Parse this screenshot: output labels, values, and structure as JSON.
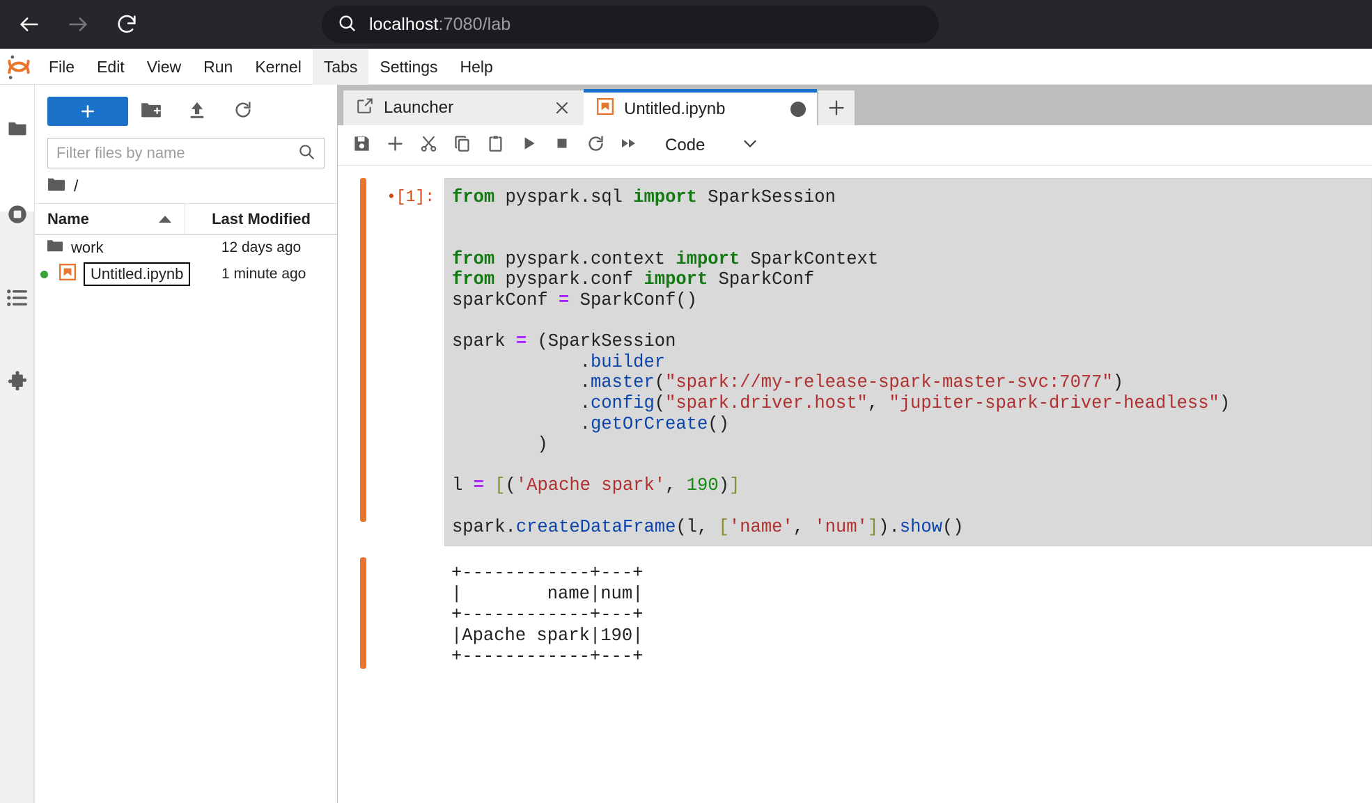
{
  "browser": {
    "back_icon": "back-arrow-icon",
    "forward_icon": "forward-arrow-icon",
    "reload_icon": "reload-icon",
    "search_icon": "search-icon",
    "url_host": "localhost",
    "url_path": ":7080/lab"
  },
  "menubar": {
    "logo": "jupyter-logo",
    "items": [
      {
        "label": "File",
        "active": false
      },
      {
        "label": "Edit",
        "active": false
      },
      {
        "label": "View",
        "active": false
      },
      {
        "label": "Run",
        "active": false
      },
      {
        "label": "Kernel",
        "active": false
      },
      {
        "label": "Tabs",
        "active": true
      },
      {
        "label": "Settings",
        "active": false
      },
      {
        "label": "Help",
        "active": false
      }
    ]
  },
  "activitybar": {
    "items": [
      {
        "name": "file-browser-icon",
        "selected": true
      },
      {
        "name": "running-terminals-and-kernels-icon",
        "selected": false
      },
      {
        "name": "commands-list-icon",
        "selected": false
      },
      {
        "name": "extension-manager-puzzle-icon",
        "selected": false
      }
    ]
  },
  "filebrowser": {
    "new_launcher_label": "+",
    "tools": [
      {
        "name": "new-folder-icon"
      },
      {
        "name": "upload-icon"
      },
      {
        "name": "refresh-icon"
      }
    ],
    "filter": {
      "placeholder": "Filter files by name",
      "value": "",
      "icon": "search-icon"
    },
    "breadcrumb": {
      "icon": "folder-icon",
      "path": "/"
    },
    "columns": {
      "name": "Name",
      "last_modified": "Last Modified",
      "sort_icon": "sort-ascending-icon"
    },
    "rows": [
      {
        "icon": "folder-icon",
        "name": "work",
        "modified": "12 days ago",
        "dirty": false,
        "selected": false,
        "renaming": false
      },
      {
        "icon": "notebook-icon",
        "name": "Untitled.ipynb",
        "modified": "1 minute ago",
        "dirty": true,
        "selected": true,
        "renaming": true
      }
    ]
  },
  "dock": {
    "tabs": [
      {
        "label": "Launcher",
        "icon": "launcher-icon",
        "active": false,
        "close_icon": "close-icon"
      },
      {
        "label": "Untitled.ipynb",
        "icon": "notebook-icon",
        "active": true,
        "dirty": true
      }
    ],
    "add_tab_label": "+"
  },
  "notebook_toolbar": {
    "buttons": [
      {
        "name": "save-icon"
      },
      {
        "name": "insert-cell-below-icon"
      },
      {
        "name": "cut-icon"
      },
      {
        "name": "copy-icon"
      },
      {
        "name": "paste-icon"
      },
      {
        "name": "run-icon"
      },
      {
        "name": "interrupt-kernel-icon"
      },
      {
        "name": "restart-kernel-icon"
      },
      {
        "name": "restart-and-run-all-icon"
      }
    ],
    "celltype": {
      "value": "Code",
      "chevron_icon": "chevron-down-icon"
    }
  },
  "notebook": {
    "cells": [
      {
        "prompt": "[1]:",
        "prompt_dot": "•",
        "code_lines": [
          [
            {
              "t": "from",
              "c": "k"
            },
            {
              "t": " pyspark.sql "
            },
            {
              "t": "import",
              "c": "k"
            },
            {
              "t": " SparkSession"
            }
          ],
          [
            {
              "t": ""
            }
          ],
          [
            {
              "t": ""
            }
          ],
          [
            {
              "t": "from",
              "c": "k"
            },
            {
              "t": " pyspark.context "
            },
            {
              "t": "import",
              "c": "k"
            },
            {
              "t": " SparkContext"
            }
          ],
          [
            {
              "t": "from",
              "c": "k"
            },
            {
              "t": " pyspark.conf "
            },
            {
              "t": "import",
              "c": "k"
            },
            {
              "t": " SparkConf"
            }
          ],
          [
            {
              "t": "sparkConf "
            },
            {
              "t": "=",
              "c": "op"
            },
            {
              "t": " SparkConf()"
            }
          ],
          [
            {
              "t": ""
            }
          ],
          [
            {
              "t": "spark "
            },
            {
              "t": "=",
              "c": "op"
            },
            {
              "t": " (SparkSession"
            }
          ],
          [
            {
              "t": "            ."
            },
            {
              "t": "builder",
              "c": "at"
            }
          ],
          [
            {
              "t": "            ."
            },
            {
              "t": "master",
              "c": "at"
            },
            {
              "t": "("
            },
            {
              "t": "\"spark://my-release-spark-master-svc:7077\"",
              "c": "st"
            },
            {
              "t": ")"
            }
          ],
          [
            {
              "t": "            ."
            },
            {
              "t": "config",
              "c": "at"
            },
            {
              "t": "("
            },
            {
              "t": "\"spark.driver.host\"",
              "c": "st"
            },
            {
              "t": ", "
            },
            {
              "t": "\"jupiter-spark-driver-headless\"",
              "c": "st"
            },
            {
              "t": ")"
            }
          ],
          [
            {
              "t": "            ."
            },
            {
              "t": "getOrCreate",
              "c": "at"
            },
            {
              "t": "()"
            }
          ],
          [
            {
              "t": "        )"
            }
          ],
          [
            {
              "t": ""
            }
          ],
          [
            {
              "t": "l "
            },
            {
              "t": "=",
              "c": "op"
            },
            {
              "t": " "
            },
            {
              "t": "[",
              "c": "br"
            },
            {
              "t": "("
            },
            {
              "t": "'Apache spark'",
              "c": "st"
            },
            {
              "t": ", "
            },
            {
              "t": "190",
              "c": "nu"
            },
            {
              "t": ")"
            },
            {
              "t": "]",
              "c": "br"
            }
          ],
          [
            {
              "t": ""
            }
          ],
          [
            {
              "t": "spark."
            },
            {
              "t": "createDataFrame",
              "c": "at"
            },
            {
              "t": "(l, "
            },
            {
              "t": "[",
              "c": "br"
            },
            {
              "t": "'name'",
              "c": "st"
            },
            {
              "t": ", "
            },
            {
              "t": "'num'",
              "c": "st"
            },
            {
              "t": "]",
              "c": "br"
            },
            {
              "t": ")."
            },
            {
              "t": "show",
              "c": "at"
            },
            {
              "t": "()"
            }
          ]
        ],
        "output_text": "+------------+---+\n|        name|num|\n+------------+---+\n|Apache spark|190|\n+------------+---+"
      }
    ]
  },
  "colors": {
    "accent_blue": "#1a73c8",
    "cell_bar_orange": "#e8762c",
    "prompt_orange": "#d24a16",
    "dirty_green": "#36a336",
    "notebook_icon_orange": "#e8762c",
    "chrome_dark": "#26262b",
    "dock_gray": "#bdbdbd",
    "code_bg": "#d9d9d9"
  }
}
